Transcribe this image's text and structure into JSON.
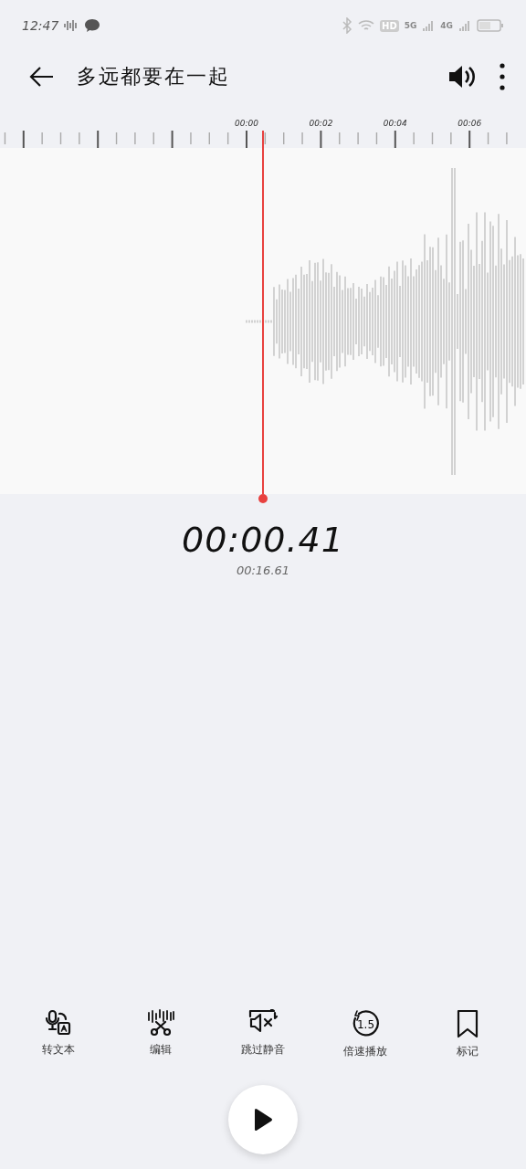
{
  "status_bar": {
    "time": "12:47",
    "hd_label": "HD",
    "sim_labels": [
      "5G",
      "4G"
    ]
  },
  "header": {
    "title": "多远都要在一起"
  },
  "timeline": {
    "tick_labels": [
      "00:00",
      "00:02",
      "00:04",
      "00:06"
    ]
  },
  "playback": {
    "position": "00:00.41",
    "duration": "00:16.61",
    "playing": false
  },
  "tools": [
    {
      "kind": "transcribe",
      "label": "转文本"
    },
    {
      "kind": "edit",
      "label": "编辑"
    },
    {
      "kind": "skip_silence",
      "label": "跳过静音"
    },
    {
      "kind": "speed",
      "label": "倍速播放",
      "icon_text": "1.5"
    },
    {
      "kind": "mark",
      "label": "标记"
    }
  ]
}
